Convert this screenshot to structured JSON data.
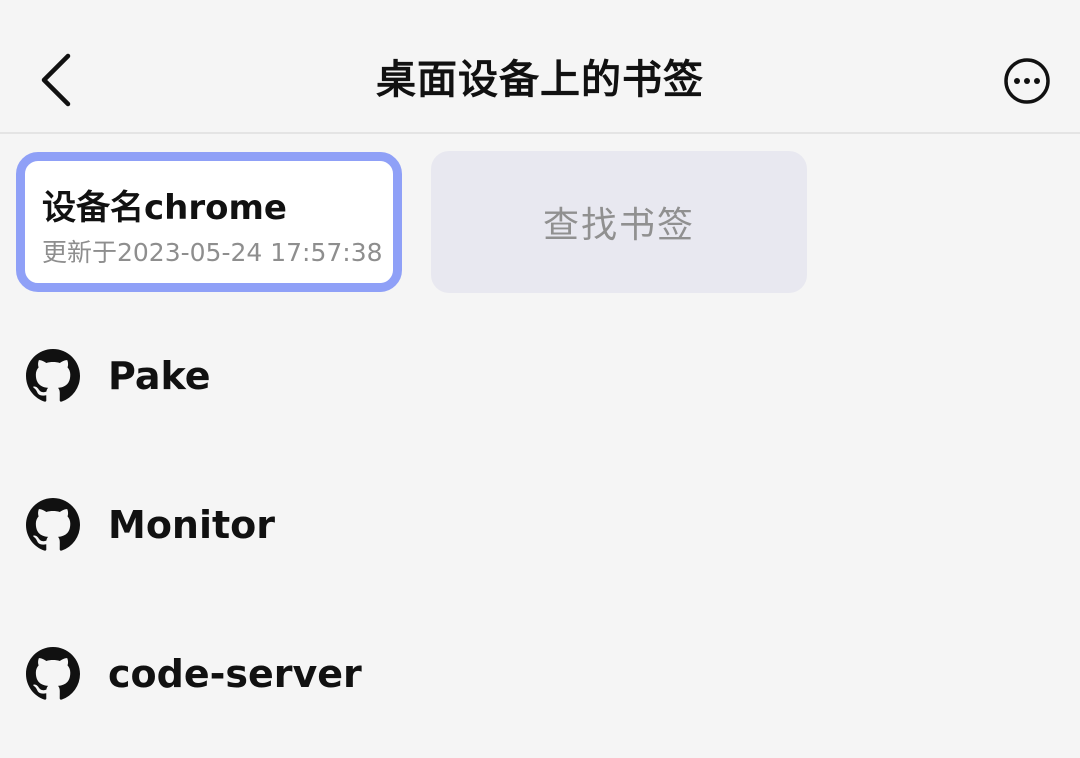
{
  "header": {
    "title": "桌面设备上的书签",
    "back_icon": "chevron-left-icon",
    "more_icon": "more-horizontal-circle-icon"
  },
  "device_card": {
    "name": "设备名chrome",
    "updated": "更新于2023-05-24 17:57:38",
    "border_color": "#8fa0f7"
  },
  "find_button": {
    "label": "查找书签"
  },
  "bookmarks": [
    {
      "icon": "github-icon",
      "label": "Pake"
    },
    {
      "icon": "github-icon",
      "label": "Monitor"
    },
    {
      "icon": "github-icon",
      "label": "code-server"
    }
  ]
}
